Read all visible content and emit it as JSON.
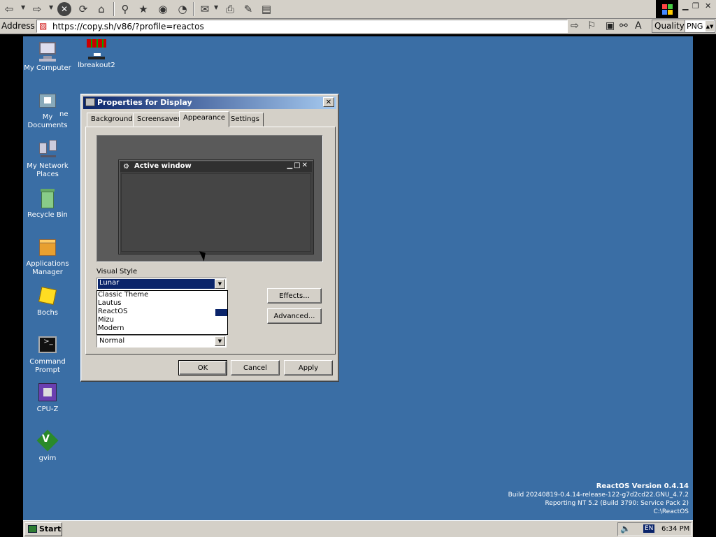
{
  "browser": {
    "address_label": "Address",
    "url": "https://copy.sh/v86/?profile=reactos",
    "quality_label": "Quality",
    "format_value": "PNG"
  },
  "desktop": {
    "icons": [
      {
        "label": "My Computer",
        "icon": "computer-icon"
      },
      {
        "label": "lbreakout2",
        "icon": "game-icon"
      },
      {
        "label": "My Documents",
        "icon": "documents-folder-icon"
      },
      {
        "label": "My Network Places",
        "icon": "network-icon"
      },
      {
        "label": "Recycle Bin",
        "icon": "recycle-bin-icon"
      },
      {
        "label": "Applications Manager",
        "icon": "app-manager-icon"
      },
      {
        "label": "Bochs",
        "icon": "bochs-icon"
      },
      {
        "label": "Command Prompt",
        "icon": "terminal-icon"
      },
      {
        "label": "CPU-Z",
        "icon": "cpu-icon"
      },
      {
        "label": "gvim",
        "icon": "vim-icon"
      }
    ],
    "partial_label": "ne"
  },
  "dialog": {
    "title": "Properties for Display",
    "close_glyph": "✕",
    "tabs": [
      "Background",
      "Screensaver",
      "Appearance",
      "Settings"
    ],
    "active_tab": "Appearance",
    "preview": {
      "window_title": "Active window",
      "controls": "▁□✕"
    },
    "visual_style_label": "Visual Style",
    "visual_style_value": "Lunar",
    "visual_style_options": [
      "Classic Theme",
      "Lautus",
      "ReactOS",
      "Mizu",
      "Modern"
    ],
    "color_scheme_value": "Normal",
    "effects_button": "Effects...",
    "advanced_button": "Advanced...",
    "ok_button": "OK",
    "cancel_button": "Cancel",
    "apply_button": "Apply"
  },
  "version": {
    "line1": "ReactOS Version 0.4.14",
    "line2": "Build 20240819-0.4.14-release-122-g7d2cd22.GNU_4.7.2",
    "line3": "Reporting NT 5.2 (Build 3790: Service Pack 2)",
    "line4": "C:\\ReactOS"
  },
  "taskbar": {
    "start_label": "Start",
    "lang": "EN",
    "clock": "6:34 PM"
  }
}
